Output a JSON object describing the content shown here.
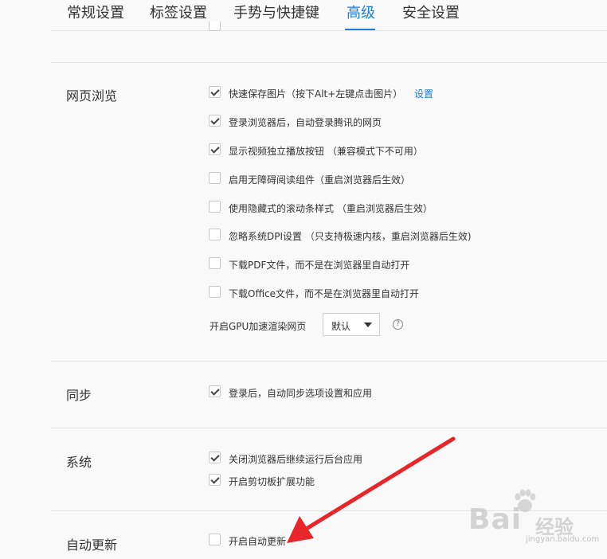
{
  "tabs": [
    {
      "label": "常规设置"
    },
    {
      "label": "标签设置"
    },
    {
      "label": "手势与快捷键"
    },
    {
      "label": "高级",
      "active": true
    },
    {
      "label": "安全设置"
    }
  ],
  "sections": {
    "web": {
      "title": "网页浏览",
      "options": [
        {
          "label": "快速保存图片（按下Alt+左键点击图片）",
          "checked": true
        },
        {
          "label": "登录浏览器后，自动登录腾讯的网页",
          "checked": true
        },
        {
          "label": "显示视频独立播放按钮 （兼容模式下不可用）",
          "checked": true
        },
        {
          "label": "启用无障碍阅读组件（重启浏览器后生效）",
          "checked": false
        },
        {
          "label": "使用隐藏式的滚动条样式 （重启浏览器后生效）",
          "checked": false
        },
        {
          "label": "忽略系统DPI设置 （只支持极速内核，重启浏览器后生效)",
          "checked": false
        },
        {
          "label": "下载PDF文件，而不是在浏览器里自动打开",
          "checked": false
        },
        {
          "label": "下载Office文件，而不是在浏览器里自动打开",
          "checked": false
        }
      ],
      "link": "设置",
      "gpu_label": "开启GPU加速渲染网页",
      "gpu_value": "默认",
      "help_symbol": "?"
    },
    "sync": {
      "title": "同步",
      "options": [
        {
          "label": "登录后，自动同步选项设置和应用",
          "checked": true
        }
      ]
    },
    "system": {
      "title": "系统",
      "options": [
        {
          "label": "关闭浏览器后继续运行后台应用",
          "checked": true
        },
        {
          "label": "开启剪切板扩展功能",
          "checked": true
        }
      ]
    },
    "update": {
      "title": "自动更新",
      "options": [
        {
          "label": "开启自动更新",
          "checked": false
        }
      ]
    }
  },
  "watermark": {
    "brand": "Bai",
    "brand2": "经验",
    "url": "jingyan.baidu.com"
  },
  "colors": {
    "accent": "#1a7fd4",
    "annotation_arrow": "#e8262a"
  }
}
